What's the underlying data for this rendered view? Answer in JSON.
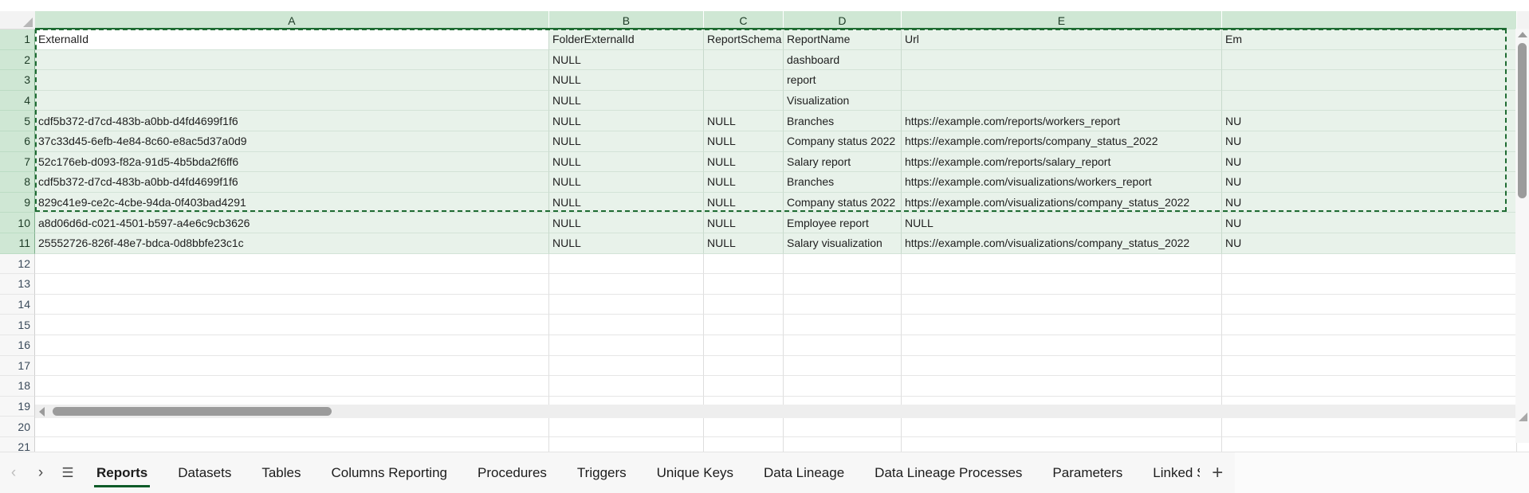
{
  "grid": {
    "column_headers": [
      "A",
      "B",
      "C",
      "D",
      "E",
      ""
    ],
    "row_numbers": [
      "1",
      "2",
      "3",
      "4",
      "5",
      "6",
      "7",
      "8",
      "9",
      "10",
      "11",
      "12",
      "13",
      "14",
      "15",
      "16",
      "17",
      "18",
      "19",
      "20",
      "21"
    ],
    "selected_rows": 11,
    "active_cell": "A1",
    "headers_row": {
      "A": "ExternalId",
      "B": "FolderExternalId",
      "C": "ReportSchema",
      "D": "ReportName",
      "E": "Url",
      "F": "Em"
    },
    "rows": [
      {
        "num": "1",
        "selected": true,
        "active": true,
        "A": "ExternalId",
        "B": "FolderExternalId",
        "C": "ReportSchema",
        "D": "ReportName",
        "E": "Url",
        "F": "Em"
      },
      {
        "num": "2",
        "selected": true,
        "active": false,
        "A": "",
        "B": "NULL",
        "C": "",
        "D": "dashboard",
        "E": "",
        "F": ""
      },
      {
        "num": "3",
        "selected": true,
        "active": false,
        "A": "",
        "B": "NULL",
        "C": "",
        "D": "report",
        "E": "",
        "F": ""
      },
      {
        "num": "4",
        "selected": true,
        "active": false,
        "A": "",
        "B": "NULL",
        "C": "",
        "D": "Visualization",
        "E": "",
        "F": ""
      },
      {
        "num": "5",
        "selected": true,
        "active": false,
        "A": "cdf5b372-d7cd-483b-a0bb-d4fd4699f1f6",
        "B": "NULL",
        "C": "NULL",
        "D": "Branches",
        "E": "https://example.com/reports/workers_report",
        "F": "NU"
      },
      {
        "num": "6",
        "selected": true,
        "active": false,
        "A": "37c33d45-6efb-4e84-8c60-e8ac5d37a0d9",
        "B": "NULL",
        "C": "NULL",
        "D": "Company status 2022",
        "E": "https://example.com/reports/company_status_2022",
        "F": "NU"
      },
      {
        "num": "7",
        "selected": true,
        "active": false,
        "A": "52c176eb-d093-f82a-91d5-4b5bda2f6ff6",
        "B": "NULL",
        "C": "NULL",
        "D": "Salary report",
        "E": "https://example.com/reports/salary_report",
        "F": "NU"
      },
      {
        "num": "8",
        "selected": true,
        "active": false,
        "A": "cdf5b372-d7cd-483b-a0bb-d4fd4699f1f6",
        "B": "NULL",
        "C": "NULL",
        "D": "Branches",
        "E": "https://example.com/visualizations/workers_report",
        "F": "NU"
      },
      {
        "num": "9",
        "selected": true,
        "active": false,
        "A": "829c41e9-ce2c-4cbe-94da-0f403bad4291",
        "B": "NULL",
        "C": "NULL",
        "D": "Company status 2022",
        "E": "https://example.com/visualizations/company_status_2022",
        "F": "NU"
      },
      {
        "num": "10",
        "selected": true,
        "active": false,
        "A": "a8d06d6d-c021-4501-b597-a4e6c9cb3626",
        "B": "NULL",
        "C": "NULL",
        "D": "Employee report",
        "E": "NULL",
        "F": "NU"
      },
      {
        "num": "11",
        "selected": true,
        "active": false,
        "A": "25552726-826f-48e7-bdca-0d8bbfe23c1c",
        "B": "NULL",
        "C": "NULL",
        "D": "Salary visualization",
        "E": "https://example.com/visualizations/company_status_2022",
        "F": "NU"
      },
      {
        "num": "12",
        "selected": false,
        "active": false,
        "A": "",
        "B": "",
        "C": "",
        "D": "",
        "E": "",
        "F": ""
      },
      {
        "num": "13",
        "selected": false,
        "active": false,
        "A": "",
        "B": "",
        "C": "",
        "D": "",
        "E": "",
        "F": ""
      },
      {
        "num": "14",
        "selected": false,
        "active": false,
        "A": "",
        "B": "",
        "C": "",
        "D": "",
        "E": "",
        "F": ""
      },
      {
        "num": "15",
        "selected": false,
        "active": false,
        "A": "",
        "B": "",
        "C": "",
        "D": "",
        "E": "",
        "F": ""
      },
      {
        "num": "16",
        "selected": false,
        "active": false,
        "A": "",
        "B": "",
        "C": "",
        "D": "",
        "E": "",
        "F": ""
      },
      {
        "num": "17",
        "selected": false,
        "active": false,
        "A": "",
        "B": "",
        "C": "",
        "D": "",
        "E": "",
        "F": ""
      },
      {
        "num": "18",
        "selected": false,
        "active": false,
        "A": "",
        "B": "",
        "C": "",
        "D": "",
        "E": "",
        "F": ""
      },
      {
        "num": "19",
        "selected": false,
        "active": false,
        "A": "",
        "B": "",
        "C": "",
        "D": "",
        "E": "",
        "F": ""
      },
      {
        "num": "20",
        "selected": false,
        "active": false,
        "A": "",
        "B": "",
        "C": "",
        "D": "",
        "E": "",
        "F": ""
      },
      {
        "num": "21",
        "selected": false,
        "active": false,
        "A": "",
        "B": "",
        "C": "",
        "D": "",
        "E": "",
        "F": ""
      }
    ]
  },
  "sheet_tabs": {
    "nav": {
      "prev": "‹",
      "next": "›",
      "list": "☰"
    },
    "add_label": "+",
    "active": "Reports",
    "items": [
      {
        "label": "Reports",
        "active": true,
        "truncated": false
      },
      {
        "label": "Datasets",
        "active": false,
        "truncated": false
      },
      {
        "label": "Tables",
        "active": false,
        "truncated": false
      },
      {
        "label": "Columns Reporting",
        "active": false,
        "truncated": false
      },
      {
        "label": "Procedures",
        "active": false,
        "truncated": false
      },
      {
        "label": "Triggers",
        "active": false,
        "truncated": false
      },
      {
        "label": "Unique Keys",
        "active": false,
        "truncated": false
      },
      {
        "label": "Data Lineage",
        "active": false,
        "truncated": false
      },
      {
        "label": "Data Lineage Processes",
        "active": false,
        "truncated": false
      },
      {
        "label": "Parameters",
        "active": false,
        "truncated": false
      },
      {
        "label": "Linked Sources",
        "active": false,
        "truncated": true
      }
    ]
  },
  "colors": {
    "selection_green": "#1e6b32",
    "header_green": "#cfe7d4",
    "selected_cell": "#e8f2ea",
    "tab_underline": "#0e5b28"
  }
}
